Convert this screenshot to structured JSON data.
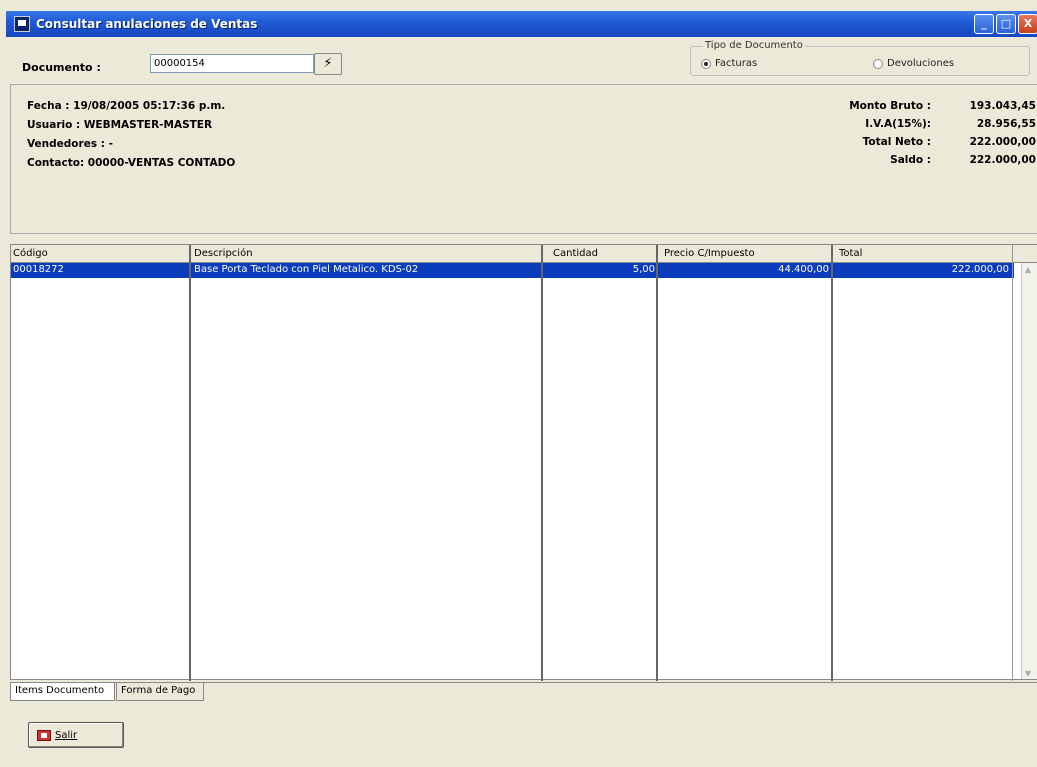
{
  "window": {
    "title": "Consultar anulaciones de Ventas",
    "minimize_symbol": "_",
    "maximize_symbol": "□",
    "close_symbol": "X"
  },
  "documento": {
    "label": "Documento :",
    "value": "00000154",
    "search_icon": "⚡"
  },
  "tipo_documento": {
    "legend": "Tipo de Documento",
    "options": [
      {
        "label": "Facturas",
        "checked": true
      },
      {
        "label": "Devoluciones",
        "checked": false
      }
    ]
  },
  "info": {
    "fecha": "Fecha   : 19/08/2005 05:17:36 p.m.",
    "usuario": "Usuario : WEBMASTER-MASTER",
    "vendedores": "Vendedores : -",
    "contacto": "Contacto: 00000-VENTAS CONTADO"
  },
  "totals": [
    {
      "label": "Monto Bruto :",
      "value": "193.043,45"
    },
    {
      "label": "I.V.A(15%):",
      "value": "28.956,55"
    },
    {
      "label": "Total Neto :",
      "value": "222.000,00"
    },
    {
      "label": "Saldo :",
      "value": "222.000,00"
    }
  ],
  "grid": {
    "columns": [
      "Código",
      "Descripción",
      "Cantidad",
      "Precio C/Impuesto",
      "Total"
    ],
    "rows": [
      {
        "codigo": "00018272",
        "descripcion": "Base Porta Teclado con Piel Metalico. KDS-02",
        "cantidad": "5,00",
        "precio": "44.400,00",
        "total": "222.000,00"
      }
    ]
  },
  "tabs": [
    "Items Documento",
    "Forma de Pago"
  ],
  "salir_label": "Salir"
}
